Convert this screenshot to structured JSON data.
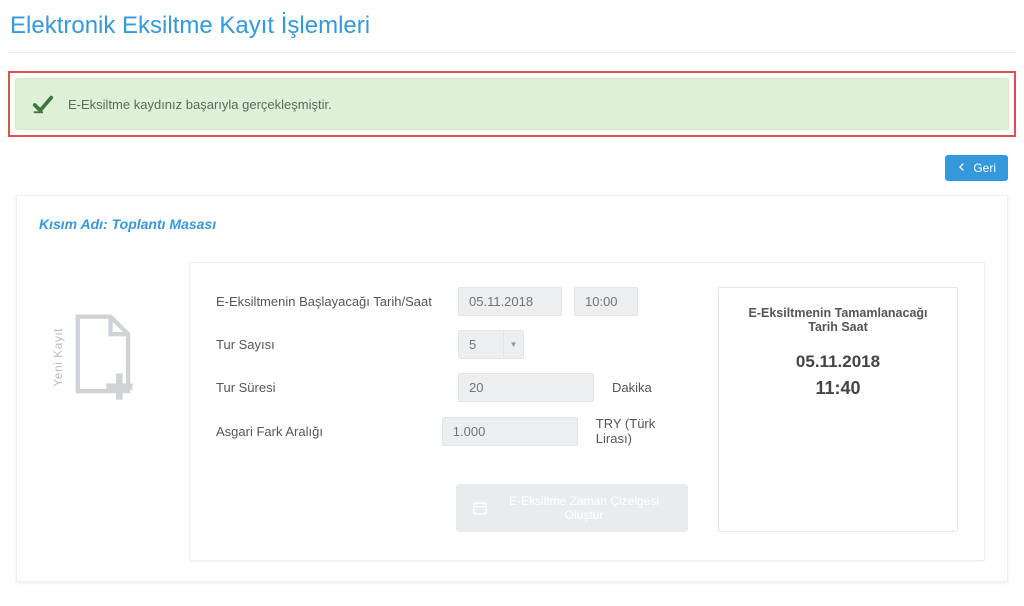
{
  "page": {
    "title": "Elektronik Eksiltme Kayıt İşlemleri"
  },
  "alert": {
    "message": "E-Eksiltme kaydınız başarıyla gerçekleşmiştir."
  },
  "actions": {
    "back_label": "Geri"
  },
  "section": {
    "title_prefix": "Kısım Adı:",
    "title_value": "Toplantı Masası"
  },
  "sidebar": {
    "new_record_label": "Yeni Kayıt"
  },
  "form": {
    "start_label": "E-Eksiltmenin Başlayacağı Tarih/Saat",
    "start_date": "05.11.2018",
    "start_time": "10:00",
    "rounds_label": "Tur Sayısı",
    "rounds_value": "5",
    "duration_label": "Tur Süresi",
    "duration_value": "20",
    "duration_unit": "Dakika",
    "min_gap_label": "Asgari Fark Aralığı",
    "min_gap_value": "1.000",
    "min_gap_unit": "TRY (Türk Lirası)",
    "schedule_button": "E-Eksiltme Zaman Çizelgesi Oluştur"
  },
  "summary": {
    "title": "E-Eksiltmenin Tamamlanacağı Tarih Saat",
    "date": "05.11.2018",
    "time": "11:40"
  }
}
